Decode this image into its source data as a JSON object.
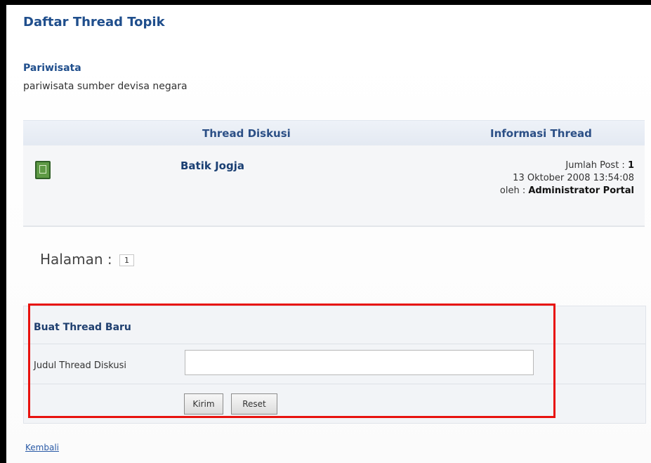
{
  "page": {
    "title": "Daftar Thread Topik"
  },
  "forum": {
    "name": "Pariwisata",
    "description": "pariwisata sumber devisa negara"
  },
  "table": {
    "col_thread": "Thread Diskusi",
    "col_info": "Informasi Thread",
    "rows": [
      {
        "title": "Batik Jogja",
        "post_count_label": "Jumlah Post :",
        "post_count": "1",
        "date": "13 Oktober 2008 13:54:08",
        "author_label": "oleh :",
        "author": "Administrator Portal"
      }
    ]
  },
  "pagination": {
    "label": "Halaman :",
    "current": "1"
  },
  "new_thread_form": {
    "title": "Buat Thread Baru",
    "field_label": "Judul Thread Diskusi",
    "field_value": "",
    "submit_label": "Kirim",
    "reset_label": "Reset"
  },
  "back_link": "Kembali",
  "colors": {
    "accent": "#1f4e8c",
    "highlight": "#e8120e",
    "icon": "#5e9a45"
  }
}
